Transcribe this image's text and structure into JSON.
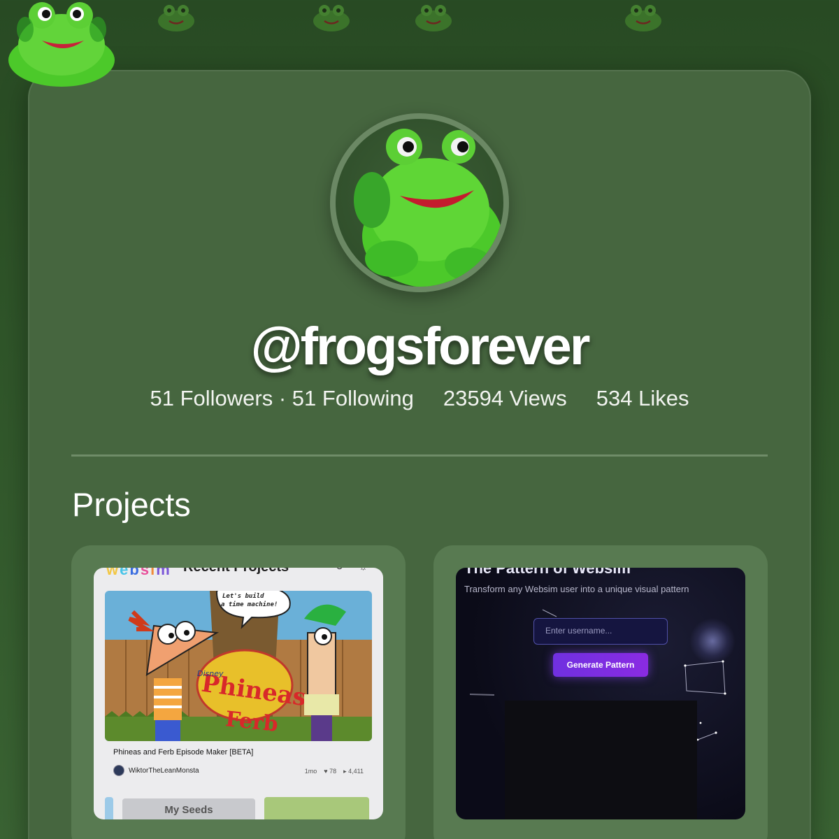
{
  "profile": {
    "username": "@frogsforever",
    "followers": "51 Followers",
    "separator": "·",
    "following": "51 Following",
    "views": "23594 Views",
    "likes": "534 Likes"
  },
  "projects": {
    "heading": "Projects",
    "items": [
      {
        "app_title": "Recent Projects",
        "logo_text": "websim",
        "refresh_icon": "refresh-icon",
        "theme_icon": "sun-icon",
        "speech_bubble": "Let's build a time machine!",
        "project_name": "Phineas and Ferb Episode Maker [BETA]",
        "author": "WiktorTheLeanMonsta",
        "age": "1mo",
        "likes": "78",
        "views": "4,411",
        "seeds_label": "My Seeds"
      },
      {
        "app_title": "The Pattern of Websim",
        "subtitle": "Transform any Websim user into a unique visual pattern",
        "input_placeholder": "Enter username...",
        "button_label": "Generate Pattern"
      }
    ]
  },
  "colors": {
    "background": "#2f5529",
    "card": "#46663f",
    "project_card": "#587a51",
    "accent_purple": "#7a2fe5"
  }
}
